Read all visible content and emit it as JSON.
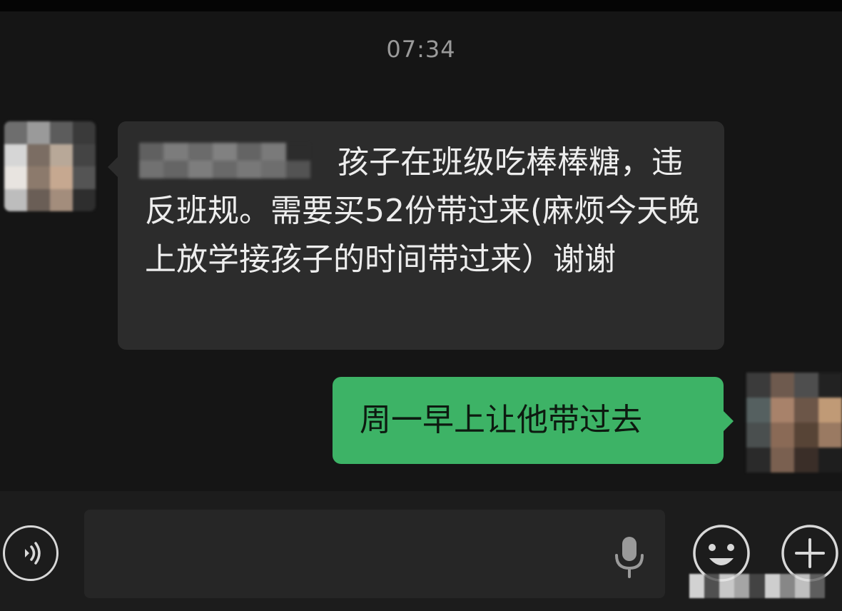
{
  "status_bar": {},
  "chat": {
    "timestamp": "07:34",
    "messages": [
      {
        "direction": "incoming",
        "sender_name_obscured": true,
        "text": "孩子在班级吃棒棒糖，违反班规。需要买52份带过来(麻烦今天晚上放学接孩子的时间带过来）谢谢"
      },
      {
        "direction": "outgoing",
        "text": "周一早上让他带过去"
      }
    ]
  },
  "input_bar": {
    "voice_icon": "voice-wave-icon",
    "text_value": "",
    "mic_icon": "microphone-icon",
    "emoji_icon": "smiley-face-icon",
    "plus_icon": "plus-circle-icon"
  },
  "colors": {
    "background": "#151515",
    "incoming_bubble": "#2c2c2c",
    "outgoing_bubble": "#3db366",
    "input_bar": "#1c1c1c"
  }
}
